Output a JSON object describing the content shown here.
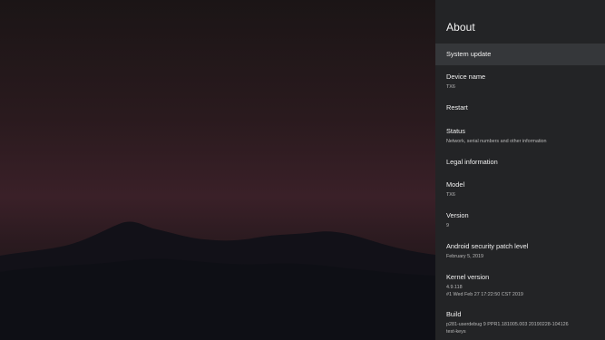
{
  "settings": {
    "title": "About",
    "items": [
      {
        "label": "System update",
        "selected": true
      },
      {
        "label": "Device name",
        "value": "TX6"
      },
      {
        "label": "Restart"
      },
      {
        "label": "Status",
        "value": "Network, serial numbers and other information"
      },
      {
        "label": "Legal information"
      },
      {
        "label": "Model",
        "value": "TX6"
      },
      {
        "label": "Version",
        "value": "9"
      },
      {
        "label": "Android security patch level",
        "value": "February 5, 2019"
      },
      {
        "label": "Kernel version",
        "value": "4.9.118",
        "value2": "#1 Wed Feb 27 17:22:50 CST 2019"
      },
      {
        "label": "Build",
        "value": "p281-userdebug 9 PPR1.181005.003 20190228-104126",
        "value2": "test-keys"
      }
    ]
  },
  "colors": {
    "panel": "#232426",
    "selected_row": "#35373a",
    "wallpaper_top": "#1b1516",
    "wallpaper_glow": "#3a2028",
    "mountains": "#111017"
  }
}
